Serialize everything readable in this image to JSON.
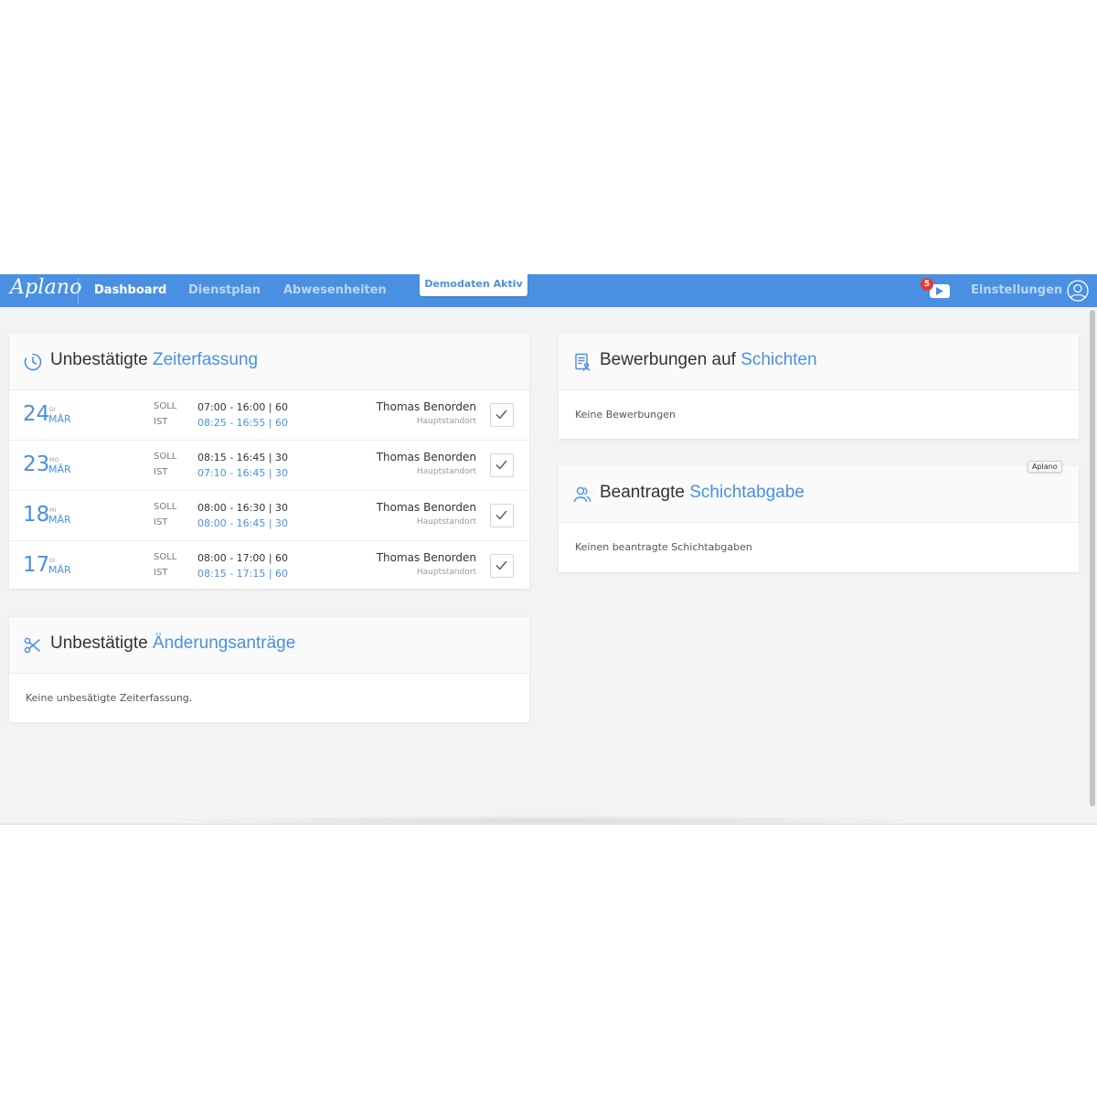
{
  "app": {
    "brand": "Aplano",
    "nav": {
      "dashboard": "Dashboard",
      "dienstplan": "Dienstplan",
      "abwesenheiten": "Abwesenheiten",
      "settings": "Einstellungen"
    },
    "demo_badge": "Demodaten Aktiv",
    "notification_count": "5",
    "active_nav": "dashboard",
    "accent_color": "#4a90e2",
    "navbar_color": "#4a90e2",
    "badge_color": "#e53935"
  },
  "timesheet": {
    "title_plain": "Unbestätigte ",
    "title_highlight": "Zeiterfassung",
    "icon": "clock-icon",
    "rows": [
      {
        "day": "24",
        "dow": "DI",
        "month": "MÄR",
        "soll_label": "SOLL",
        "soll": "07:00 - 16:00 | 60",
        "ist_label": "IST",
        "ist": "08:25 - 16:55 | 60",
        "employee": "Thomas Benorden",
        "location": "Hauptstandort"
      },
      {
        "day": "23",
        "dow": "MO",
        "month": "MÄR",
        "soll_label": "SOLL",
        "soll": "08:15 - 16:45 | 30",
        "ist_label": "IST",
        "ist": "07:10 - 16:45 | 30",
        "employee": "Thomas Benorden",
        "location": "Hauptstandort"
      },
      {
        "day": "18",
        "dow": "MI",
        "month": "MÄR",
        "soll_label": "SOLL",
        "soll": "08:00 - 16:30 | 30",
        "ist_label": "IST",
        "ist": "08:00 - 16:45 | 30",
        "employee": "Thomas Benorden",
        "location": "Hauptstandort"
      },
      {
        "day": "17",
        "dow": "DI",
        "month": "MÄR",
        "soll_label": "SOLL",
        "soll": "08:00 - 17:00 | 60",
        "ist_label": "IST",
        "ist": "08:15 - 17:15 | 60",
        "employee": "Thomas Benorden",
        "location": "Hauptstandort"
      }
    ]
  },
  "changes": {
    "title_plain": "Unbestätigte ",
    "title_highlight": "Änderungsanträge",
    "icon": "scissors-icon",
    "empty": "Keine unbesätigte Zeiterfassung."
  },
  "applications": {
    "title_plain": "Bewerbungen auf ",
    "title_highlight": "Schichten",
    "icon": "document-user-icon",
    "empty": "Keine Bewerbungen"
  },
  "handovers": {
    "title_plain": "Beantragte ",
    "title_highlight": "Schichtabgabe",
    "icon": "users-icon",
    "empty": "Keinen beantragte Schichtabgaben",
    "tooltip": "Aplano"
  }
}
